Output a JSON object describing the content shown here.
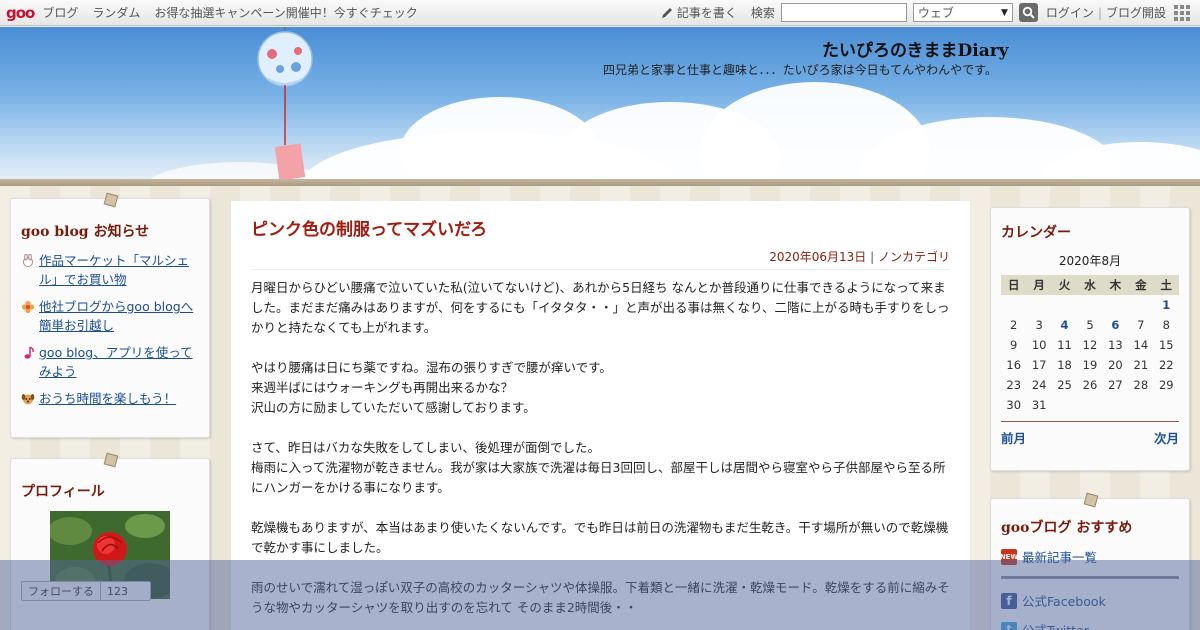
{
  "topbar": {
    "logo": "goo",
    "links": [
      "ブログ",
      "ランダム",
      "お得な抽選キャンペーン開催中！今すぐチェック"
    ],
    "write_label": "記事を書く",
    "search_label": "検索",
    "search_value": "",
    "search_scope": "ウェブ",
    "login": "ログイン",
    "open_blog": "ブログ開設"
  },
  "header": {
    "title": "たいぴろのきままDiary",
    "description": "四兄弟と家事と仕事と趣味と．．．たいぴろ家は今日もてんやわんやです。"
  },
  "notice": {
    "title": "goo blog お知らせ",
    "items": [
      {
        "label": "作品マーケット「マルシェル」でお買い物",
        "icon": "rabbit-icon"
      },
      {
        "label": "他社ブログからgoo blogへ簡単お引越し",
        "icon": "flower-icon"
      },
      {
        "label": "goo blog、アプリを使ってみよう",
        "icon": "music-note-icon"
      },
      {
        "label": "おうち時間を楽しもう！",
        "icon": "dog-icon"
      }
    ]
  },
  "profile": {
    "title": "プロフィール",
    "follow_label": "フォローする",
    "follow_count": "123"
  },
  "post": {
    "title": "ピンク色の制服ってマズいだろ",
    "date": "2020年06月13日",
    "separator": "|",
    "category": "ノンカテゴリ",
    "paragraphs": [
      "月曜日からひどい腰痛で泣いていた私(泣いてないけど)、あれから5日経ち なんとか普段通りに仕事できるようになって来ました。まだまだ痛みはありますが、何をするにも「イタタタ・・」と声が出る事は無くなり、二階に上がる時も手すりをしっかりと持たなくても上がれます。",
      "やはり腰痛は日にち薬ですね。湿布の張りすぎで腰が痒いです。\n来週半ばにはウォーキングも再開出来るかな？\n沢山の方に励ましていただいて感謝しております。",
      "さて、昨日はバカな失敗をしてしまい、後処理が面倒でした。\n梅雨に入って洗濯物が乾きません。我が家は大家族で洗濯は毎日3回回し、部屋干しは居間やら寝室やら子供部屋やら至る所にハンガーをかける事になります。",
      "乾燥機もありますが、本当はあまり使いたくないんです。でも昨日は前日の洗濯物もまだ生乾き。干す場所が無いので乾燥機で乾かす事にしました。",
      "雨のせいで濡れて湿っぽい双子の高校のカッターシャツや体操服。下着類と一緒に洗濯・乾燥モード。乾燥をする前に縮みそうな物やカッターシャツを取り出すのを忘れて そのまま2時間後・・"
    ]
  },
  "calendar": {
    "title": "カレンダー",
    "caption": "2020年8月",
    "weekdays": [
      "日",
      "月",
      "火",
      "水",
      "木",
      "金",
      "土"
    ],
    "weeks": [
      [
        "",
        "",
        "",
        "",
        "",
        "",
        "1"
      ],
      [
        "2",
        "3",
        "4",
        "5",
        "6",
        "7",
        "8"
      ],
      [
        "9",
        "10",
        "11",
        "12",
        "13",
        "14",
        "15"
      ],
      [
        "16",
        "17",
        "18",
        "19",
        "20",
        "21",
        "22"
      ],
      [
        "23",
        "24",
        "25",
        "26",
        "27",
        "28",
        "29"
      ],
      [
        "30",
        "31",
        "",
        "",
        "",
        "",
        ""
      ]
    ],
    "linked_days": [
      "1",
      "4",
      "6"
    ],
    "prev": "前月",
    "next": "次月"
  },
  "recommend": {
    "title": "gooブログ おすすめ",
    "latest": "最新記事一覧",
    "new_badge": "NEW",
    "facebook": "公式Facebook",
    "twitter": "公式Twitter"
  },
  "colors": {
    "accent": "#a31b0e",
    "link": "#1a4f95",
    "sky": "#4a8ed4"
  }
}
